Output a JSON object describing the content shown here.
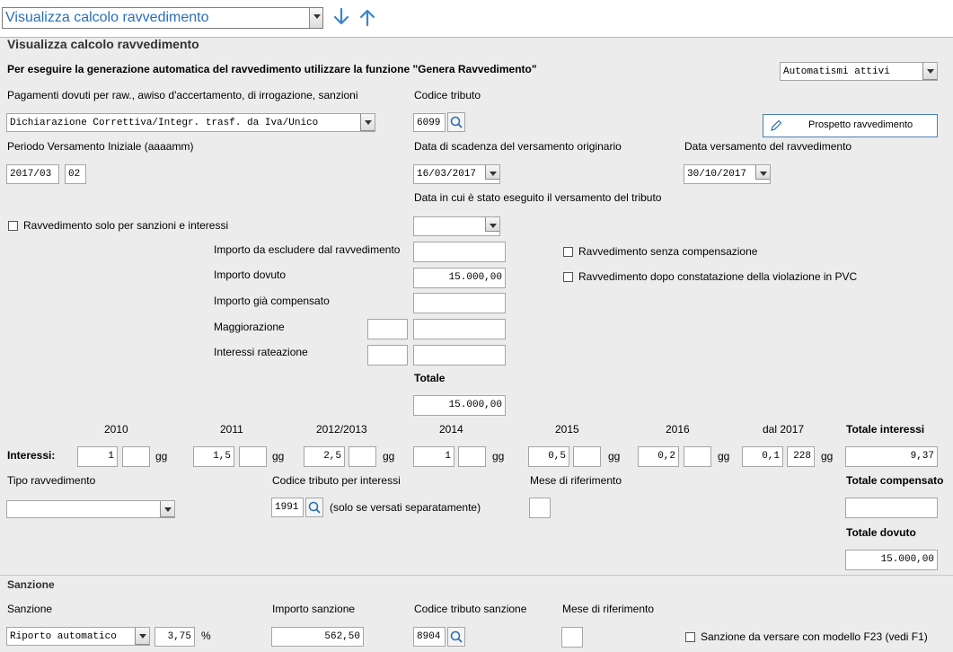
{
  "toolbar": {
    "view_select": "Visualizza calcolo ravvedimento",
    "down_arrow": "arrow-down-icon",
    "up_arrow": "arrow-up-icon"
  },
  "page_title": "Visualizza calcolo ravvedimento",
  "info_text": "Per eseguire la generazione automatica del ravvedimento utilizzare la funzione \"Genera Ravvedimento\"",
  "automatismi": "Automatismi attivi",
  "pagamenti": {
    "label": "Pagamenti dovuti per raw., awiso d'accertamento, di irrogazione, sanzioni",
    "value": "Dichiarazione Correttiva/Integr. trasf. da Iva/Unico"
  },
  "codice_tributo": {
    "label": "Codice tributo",
    "value": "6099"
  },
  "prospetto_button": "Prospetto ravvedimento",
  "periodo": {
    "label": "Periodo Versamento Iniziale (aaaamm)",
    "value1": "2017/03",
    "value2": "02"
  },
  "data_scadenza": {
    "label": "Data di scadenza del versamento originario",
    "value": "16/03/2017"
  },
  "data_versamento": {
    "label": "Data versamento del ravvedimento",
    "value": "30/10/2017"
  },
  "data_eseguito": {
    "label": "Data in cui è stato eseguito il versamento del tributo",
    "value": ""
  },
  "solo_sanzioni": "Ravvedimento solo per sanzioni e interessi",
  "importo_escludere": {
    "label": "Importo da escludere dal ravvedimento",
    "value": ""
  },
  "importo_dovuto": {
    "label": "Importo dovuto",
    "value": "15.000,00"
  },
  "importo_compensato": {
    "label": "Importo già compensato",
    "value": ""
  },
  "maggiorazione": {
    "label": "Maggiorazione",
    "value1": "",
    "value2": ""
  },
  "interessi_rateazione": {
    "label": "Interessi rateazione",
    "value1": "",
    "value2": ""
  },
  "senza_compensazione": "Ravvedimento senza compensazione",
  "dopo_pvc": "Ravvedimento dopo constatazione della violazione in PVC",
  "totale": {
    "label": "Totale",
    "value": "15.000,00"
  },
  "interessi": {
    "label": "Interessi:",
    "gg": "gg",
    "years": [
      {
        "year": "2010",
        "rate": "1",
        "gg": ""
      },
      {
        "year": "2011",
        "rate": "1,5",
        "gg": ""
      },
      {
        "year": "2012/2013",
        "rate": "2,5",
        "gg": ""
      },
      {
        "year": "2014",
        "rate": "1",
        "gg": ""
      },
      {
        "year": "2015",
        "rate": "0,5",
        "gg": ""
      },
      {
        "year": "2016",
        "rate": "0,2",
        "gg": ""
      },
      {
        "year": "dal 2017",
        "rate": "0,1",
        "gg": "228"
      }
    ],
    "totale_label": "Totale interessi",
    "totale_value": "9,37"
  },
  "tipo_ravvedimento": {
    "label": "Tipo ravvedimento",
    "value": ""
  },
  "codice_interessi": {
    "label": "Codice tributo per interessi",
    "value": "1991",
    "note": "(solo se versati separatamente)"
  },
  "mese_riferimento": {
    "label": "Mese di riferimento",
    "value": ""
  },
  "totale_compensato": {
    "label": "Totale compensato",
    "value": ""
  },
  "totale_dovuto": {
    "label": "Totale dovuto",
    "value": "15.000,00"
  },
  "sanzione": {
    "section": "Sanzione",
    "label": "Sanzione",
    "value": "Riporto automatico",
    "percent": "3,75",
    "percent_sign": "%",
    "importo_label": "Importo sanzione",
    "importo_value": "562,50",
    "codice_label": "Codice tributo sanzione",
    "codice_value": "8904",
    "mese_label": "Mese di riferimento",
    "mese_value": "",
    "f23": "Sanzione da versare con modello F23 (vedi F1)"
  }
}
